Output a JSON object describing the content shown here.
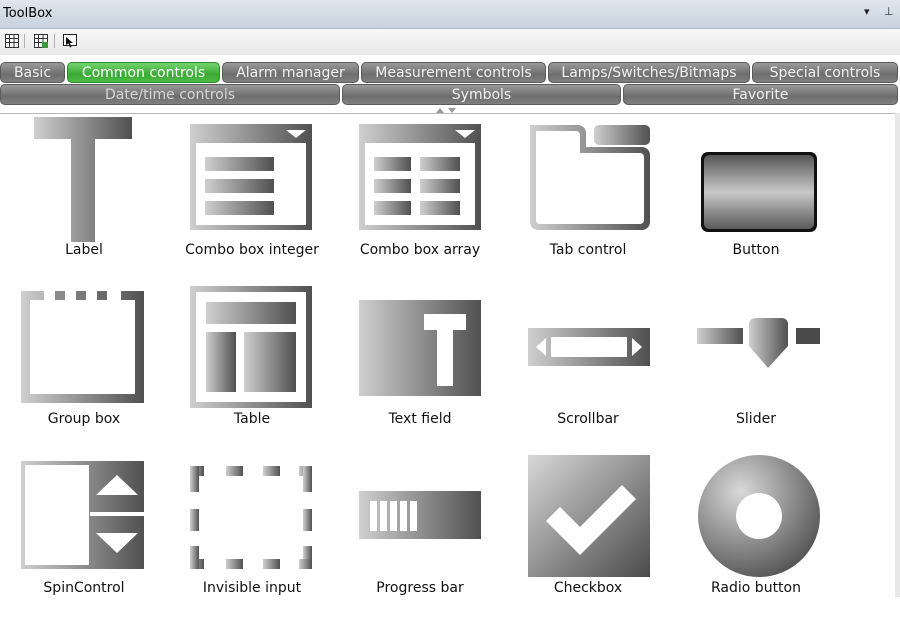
{
  "window": {
    "title": "ToolBox",
    "dropdown_glyph": "▾",
    "pin_glyph": "⊥"
  },
  "toolbar": {
    "icons": [
      "grid-icon",
      "grid-add-icon",
      "zoom-pointer-icon"
    ]
  },
  "tabs": {
    "row1": [
      "Basic",
      "Common controls",
      "Alarm manager",
      "Measurement controls",
      "Lamps/Switches/Bitmaps",
      "Special controls"
    ],
    "row2": [
      "Date/time controls",
      "Symbols",
      "Favorite"
    ],
    "active": "Common controls"
  },
  "items": [
    {
      "label": "Label",
      "icon": "label-icon"
    },
    {
      "label": "Combo box integer",
      "icon": "combo-box-integer-icon"
    },
    {
      "label": "Combo box array",
      "icon": "combo-box-array-icon"
    },
    {
      "label": "Tab control",
      "icon": "tab-control-icon"
    },
    {
      "label": "Button",
      "icon": "button-icon"
    },
    {
      "label": "Group box",
      "icon": "group-box-icon"
    },
    {
      "label": "Table",
      "icon": "table-icon"
    },
    {
      "label": "Text field",
      "icon": "text-field-icon"
    },
    {
      "label": "Scrollbar",
      "icon": "scrollbar-icon"
    },
    {
      "label": "Slider",
      "icon": "slider-icon"
    },
    {
      "label": "SpinControl",
      "icon": "spin-control-icon"
    },
    {
      "label": "Invisible input",
      "icon": "invisible-input-icon"
    },
    {
      "label": "Progress bar",
      "icon": "progress-bar-icon"
    },
    {
      "label": "Checkbox",
      "icon": "checkbox-icon"
    },
    {
      "label": "Radio button",
      "icon": "radio-button-icon"
    }
  ],
  "colors": {
    "active_tab": "#3aa934",
    "tab": "#7a7a7a",
    "icon_dark": "#555555",
    "icon_light": "#cfcfcf"
  }
}
